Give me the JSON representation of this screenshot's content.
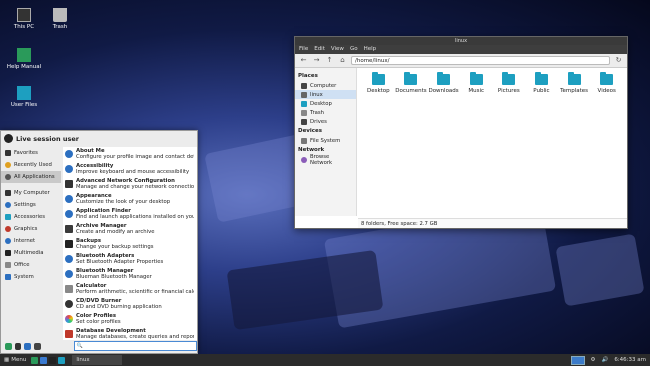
{
  "desktop": {
    "icons": [
      {
        "label": "This PC",
        "icon": "computer-icon"
      },
      {
        "label": "Trash",
        "icon": "trash-icon"
      },
      {
        "label": "Help Manual",
        "icon": "book-icon"
      },
      {
        "label": "User Files",
        "icon": "home-folder-icon"
      }
    ]
  },
  "file_manager": {
    "title": "linux",
    "menu": [
      "File",
      "Edit",
      "View",
      "Go",
      "Help"
    ],
    "path": "/home/linux/",
    "sidebar": {
      "places_header": "Places",
      "places": [
        "Computer",
        "linux",
        "Desktop",
        "Trash",
        "Drives"
      ],
      "devices_header": "Devices",
      "devices": [
        "File System"
      ],
      "network_header": "Network",
      "network": [
        "Browse Network"
      ]
    },
    "folders": [
      "Desktop",
      "Documents",
      "Downloads",
      "Music",
      "Pictures",
      "Public",
      "Templates",
      "Videos"
    ],
    "status": "8 folders, Free space: 2.7 GB"
  },
  "menu": {
    "user": "Live session user",
    "categories": [
      "Favorites",
      "Recently Used",
      "All Applications",
      "My Computer",
      "Settings",
      "Accessories",
      "Graphics",
      "Internet",
      "Multimedia",
      "Office",
      "System"
    ],
    "apps": [
      {
        "title": "About Me",
        "desc": "Configure your profile image and contact details"
      },
      {
        "title": "Accessibility",
        "desc": "Improve keyboard and mouse accessibility"
      },
      {
        "title": "Advanced Network Configuration",
        "desc": "Manage and change your network connection s..."
      },
      {
        "title": "Appearance",
        "desc": "Customize the look of your desktop"
      },
      {
        "title": "Application Finder",
        "desc": "Find and launch applications installed on your ..."
      },
      {
        "title": "Archive Manager",
        "desc": "Create and modify an archive"
      },
      {
        "title": "Backups",
        "desc": "Change your backup settings"
      },
      {
        "title": "Bluetooth Adapters",
        "desc": "Set Bluetooth Adapter Properties"
      },
      {
        "title": "Bluetooth Manager",
        "desc": "Blueman Bluetooth Manager"
      },
      {
        "title": "Calculator",
        "desc": "Perform arithmetic, scientific or financial calcul..."
      },
      {
        "title": "CD/DVD Burner",
        "desc": "CD and DVD burning application"
      },
      {
        "title": "Color Profiles",
        "desc": "Set color profiles"
      },
      {
        "title": "Database Development",
        "desc": "Manage databases, create queries and reports t..."
      }
    ]
  },
  "taskbar": {
    "menu_label": "Menu",
    "task": "linux",
    "clock": "6:46:33 am"
  }
}
